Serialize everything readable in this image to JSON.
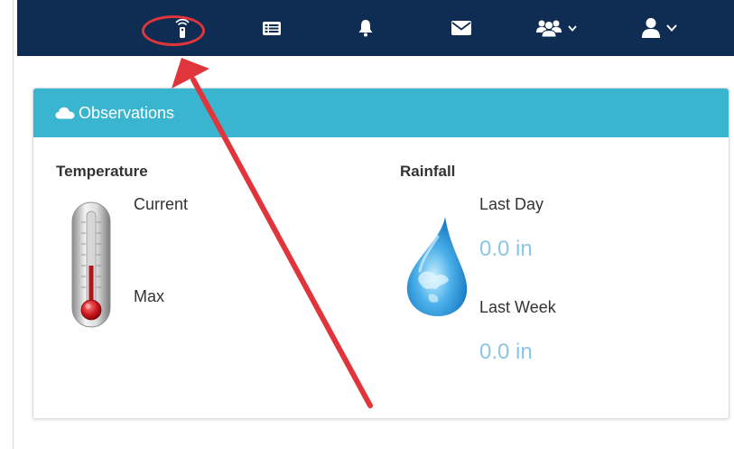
{
  "navbar": {
    "items": [
      {
        "icon": "remote-sensor-icon"
      },
      {
        "icon": "list-icon"
      },
      {
        "icon": "bell-icon"
      },
      {
        "icon": "envelope-icon"
      },
      {
        "icon": "users-icon",
        "has_dropdown": true
      },
      {
        "icon": "user-icon",
        "has_dropdown": true
      }
    ]
  },
  "panel": {
    "title": "Observations",
    "icon": "cloud-icon"
  },
  "temperature": {
    "title": "Temperature",
    "current_label": "Current",
    "max_label": "Max"
  },
  "rainfall": {
    "title": "Rainfall",
    "last_day_label": "Last Day",
    "last_day_value": "0.0 in",
    "last_week_label": "Last Week",
    "last_week_value": "0.0 in"
  },
  "colors": {
    "navbar_bg": "#0f2d52",
    "panel_header_bg": "#3ab5d0",
    "value_text": "#8ac6e6",
    "annotation_red": "#e0353b"
  }
}
